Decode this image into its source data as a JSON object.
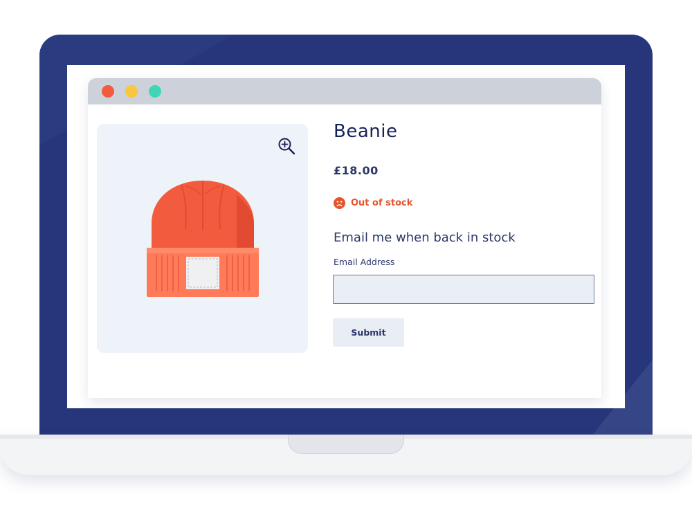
{
  "window": {
    "controls": [
      {
        "name": "close",
        "color": "#f35b3f"
      },
      {
        "name": "minimize",
        "color": "#f8c73d"
      },
      {
        "name": "maximize",
        "color": "#3fd6b5"
      }
    ]
  },
  "product": {
    "title": "Beanie",
    "price": "£18.00",
    "image_icon": "beanie-hat",
    "zoom_icon": "zoom-in-icon",
    "stock": {
      "status": "Out of stock",
      "icon": "sad-face-icon",
      "color": "#e5542c"
    }
  },
  "notify": {
    "heading": "Email me when back in stock",
    "email_label": "Email Address",
    "email_value": "",
    "submit_label": "Submit"
  },
  "colors": {
    "accent": "#f35b3f",
    "text": "#2c3768",
    "laptop": "#27367a"
  }
}
